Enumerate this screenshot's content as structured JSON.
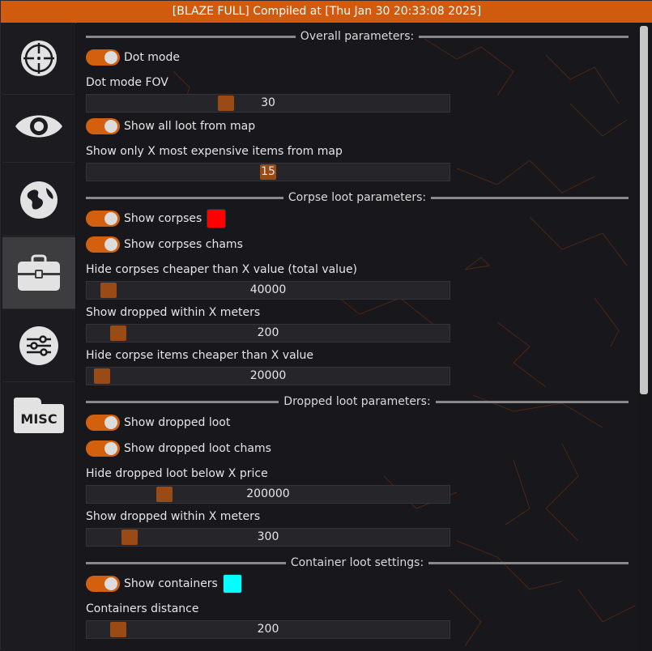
{
  "title": "[BLAZE FULL] Compiled at [Thu Jan 30 20:33:08 2025]",
  "sidebar": {
    "items": [
      {
        "icon": "crosshair-icon"
      },
      {
        "icon": "eye-icon"
      },
      {
        "icon": "globe-icon"
      },
      {
        "icon": "briefcase-icon",
        "active": true
      },
      {
        "icon": "sliders-icon"
      },
      {
        "icon": "misc-folder-icon",
        "label": "MISC"
      }
    ]
  },
  "sections": {
    "overall": "Overall parameters:",
    "corpse": "Corpse loot parameters:",
    "dropped": "Dropped loot parameters:",
    "container": "Container loot settings:"
  },
  "overall": {
    "dot_mode": "Dot mode",
    "dot_mode_fov_label": "Dot mode FOV",
    "dot_mode_fov_value": "30",
    "show_all_loot": "Show all loot from map",
    "show_only_x_label": "Show only X most expensive items from map",
    "show_only_x_value": "15"
  },
  "corpse": {
    "show_corpses": "Show corpses",
    "show_corpses_color": "#ff0000",
    "show_corpses_chams": "Show corpses chams",
    "hide_cheaper_label": "Hide corpses cheaper than X value (total value)",
    "hide_cheaper_value": "40000",
    "dropped_within_label": "Show dropped within X meters",
    "dropped_within_value": "200",
    "hide_items_label": "Hide corpse items cheaper than X value",
    "hide_items_value": "20000"
  },
  "dropped": {
    "show_dropped": "Show dropped loot",
    "show_dropped_chams": "Show dropped loot chams",
    "hide_below_label": "Hide dropped loot below X price",
    "hide_below_value": "200000",
    "within_label": "Show dropped within X meters",
    "within_value": "300"
  },
  "container": {
    "show_containers": "Show containers",
    "show_containers_color": "#00ffff",
    "distance_label": "Containers distance",
    "distance_value": "200"
  },
  "colors": {
    "accent": "#d2600f",
    "titlebar": "#d05a0e",
    "slider_thumb": "#9a4a14"
  }
}
